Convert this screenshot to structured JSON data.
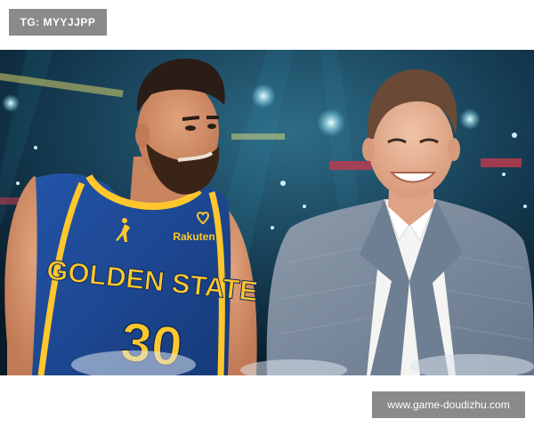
{
  "top_badge": {
    "text": "TG: MYYJJPP"
  },
  "bottom_badge": {
    "text": "www.game-doudizhu.com"
  },
  "photo": {
    "jersey": {
      "brand": "Rakuten",
      "team": "GOLDEN STATE",
      "number": "30",
      "color": "#1d428a",
      "trim_color": "#ffc72c"
    },
    "suit_color": "#7b8a9c",
    "arena_color": "#0d2233"
  }
}
